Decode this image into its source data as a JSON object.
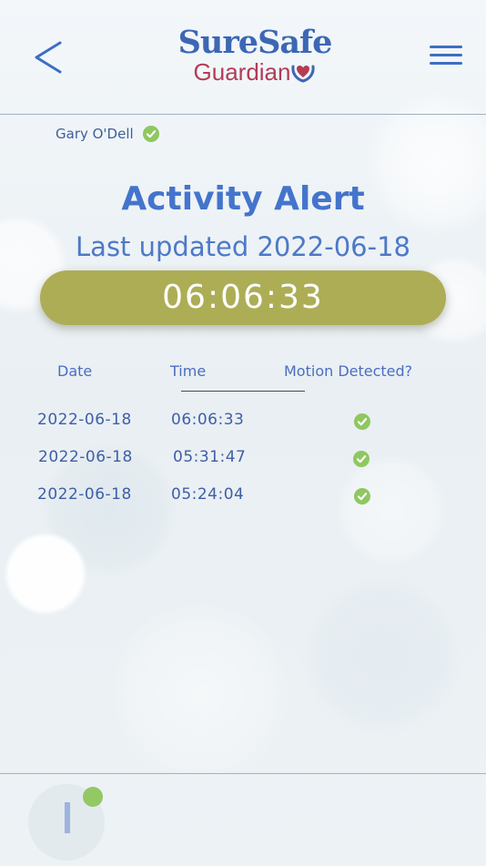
{
  "header": {
    "logo_top": "SureSafe",
    "logo_bottom": "Guardian"
  },
  "user": {
    "name": "Gary O'Dell"
  },
  "alert": {
    "title": "Activity Alert",
    "last_updated": "Last updated 2022-06-18",
    "time": "06:06:33"
  },
  "table": {
    "headers": [
      "Date",
      "Time",
      "Motion Detected?"
    ],
    "rows": [
      {
        "date": "2022-06-18",
        "time": "06:06:33",
        "motion": true
      },
      {
        "date": "2022-06-18",
        "time": "05:31:47",
        "motion": true
      },
      {
        "date": "2022-06-18",
        "time": "05:24:04",
        "motion": true
      }
    ]
  },
  "colors": {
    "brand_blue": "#3c67b4",
    "brand_red": "#b33c56",
    "pill": "#adad56",
    "check_green": "#8fc760"
  },
  "icons": {
    "back": "chevron-left-icon",
    "menu": "hamburger-menu-icon",
    "check": "check-circle-icon",
    "heart": "heart-hands-icon"
  }
}
